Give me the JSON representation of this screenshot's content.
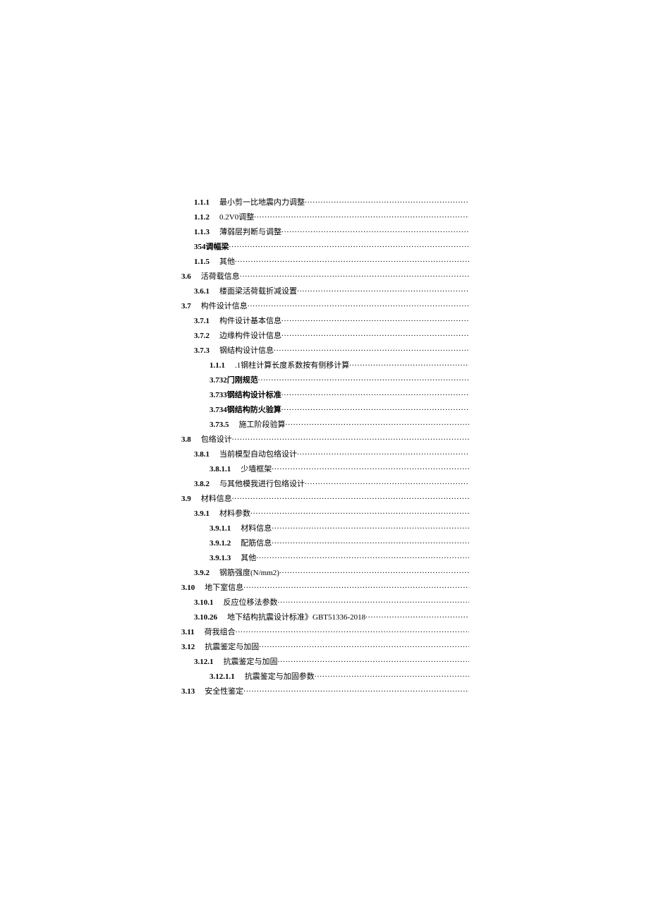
{
  "toc": [
    {
      "num": "1.1.1",
      "title": "最小剪一比地震内力调整",
      "indent": 1,
      "boldTitle": false
    },
    {
      "num": "1.1.2",
      "title": "0.2V0调整",
      "indent": 1,
      "boldTitle": false
    },
    {
      "num": "1.1.3",
      "title": "薄弱层判断与调整",
      "indent": 1,
      "boldTitle": false
    },
    {
      "num": "",
      "title": "354调幅梁",
      "indent": 1,
      "boldTitle": true
    },
    {
      "num": "1.1.5",
      "title": "其他",
      "indent": 1,
      "boldTitle": false
    },
    {
      "num": "3.6",
      "title": "活荷载信息",
      "indent": 0,
      "boldTitle": false
    },
    {
      "num": "3.6.1",
      "title": "楼面梁活荷载折减设置",
      "indent": 1,
      "boldTitle": false
    },
    {
      "num": "3.7",
      "title": "构件设计信息",
      "indent": 0,
      "boldTitle": false
    },
    {
      "num": "3.7.1",
      "title": "构件设计基本信息",
      "indent": 1,
      "boldTitle": false
    },
    {
      "num": "3.7.2",
      "title": "边缘构件设计信息",
      "indent": 1,
      "boldTitle": false
    },
    {
      "num": "3.7.3",
      "title": "钢结构设计信息",
      "indent": 1,
      "boldTitle": false
    },
    {
      "num": "1.1.1",
      "title": ".1钢柱计算长度系数按有侧移计算",
      "indent": 2,
      "boldTitle": false
    },
    {
      "num": "",
      "title": "3.732门刚规范",
      "indent": 2,
      "boldTitle": true
    },
    {
      "num": "",
      "title": "3.733钢结构设计标准",
      "indent": 2,
      "boldTitle": true
    },
    {
      "num": "",
      "title": "3.734钢结构防火验算",
      "indent": 2,
      "boldTitle": true
    },
    {
      "num": "3.73.5",
      "title": "施工阶段验算",
      "indent": 2,
      "boldTitle": false
    },
    {
      "num": "3.8",
      "title": "包络设计",
      "indent": 0,
      "boldTitle": false
    },
    {
      "num": "3.8.1",
      "title": "当前模型自动包络设计",
      "indent": 1,
      "boldTitle": false
    },
    {
      "num": "3.8.1.1",
      "title": "少墙框架",
      "indent": 2,
      "boldTitle": false
    },
    {
      "num": "3.8.2",
      "title": "与其他模我进行包络设计",
      "indent": 1,
      "boldTitle": false
    },
    {
      "num": "3.9",
      "title": "材料信息",
      "indent": 0,
      "boldTitle": false
    },
    {
      "num": "3.9.1",
      "title": "材料参数",
      "indent": 1,
      "boldTitle": false
    },
    {
      "num": "3.9.1.1",
      "title": "材料信息",
      "indent": 2,
      "boldTitle": false
    },
    {
      "num": "3.9.1.2",
      "title": "配筋信息",
      "indent": 2,
      "boldTitle": false
    },
    {
      "num": "3.9.1.3",
      "title": "其他",
      "indent": 2,
      "boldTitle": false
    },
    {
      "num": "3.9.2",
      "title": "钢筋强度(N/mm2)",
      "indent": 1,
      "boldTitle": false
    },
    {
      "num": "3.10",
      "title": "地下室信息",
      "indent": 0,
      "boldTitle": false
    },
    {
      "num": "3.10.1",
      "title": "反应位移法参数",
      "indent": 1,
      "boldTitle": false
    },
    {
      "num": "3.10.26",
      "title": "地下结构抗震设计标准》GBT51336-2018",
      "indent": 1,
      "boldTitle": false
    },
    {
      "num": "3.11",
      "title": "荷我组合",
      "indent": 0,
      "boldTitle": false
    },
    {
      "num": "3.12",
      "title": "抗震鉴定与加固",
      "indent": 0,
      "boldTitle": false
    },
    {
      "num": "3.12.1",
      "title": "抗震鉴定与加固",
      "indent": 1,
      "boldTitle": false
    },
    {
      "num": "3.12.1.1",
      "title": "抗震鉴定与加固参数",
      "indent": 2,
      "boldTitle": false
    },
    {
      "num": "3.13",
      "title": "安全性鉴定",
      "indent": 0,
      "boldTitle": false
    }
  ]
}
